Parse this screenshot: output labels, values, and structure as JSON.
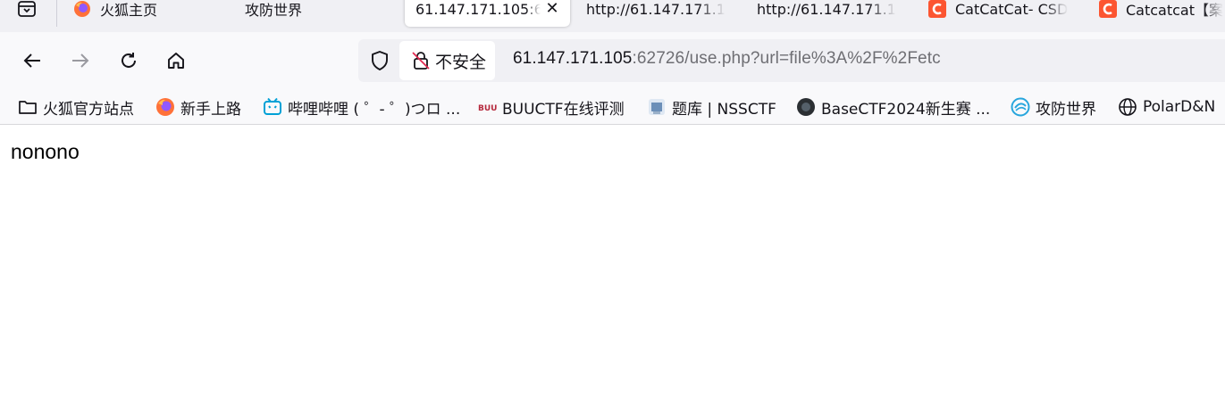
{
  "tabs": [
    {
      "title": "火狐主页",
      "icon": "firefox-icon"
    },
    {
      "title": "攻防世界",
      "icon": ""
    },
    {
      "title": "61.147.171.105:6",
      "icon": "",
      "active": true,
      "close": "✕"
    },
    {
      "title": "http://61.147.171.1",
      "icon": ""
    },
    {
      "title": "http://61.147.171.1",
      "icon": ""
    },
    {
      "title": "CatCatCat- CSD",
      "icon": "csdn-icon"
    },
    {
      "title": "Catcatcat【案",
      "icon": "csdn-icon"
    }
  ],
  "urlbar": {
    "insecure_label": "不安全",
    "host": "61.147.171.105",
    "rest": ":62726/use.php?url=file%3A%2F%2Fetc"
  },
  "bookmarks": [
    {
      "label": "火狐官方站点",
      "icon": "folder-icon"
    },
    {
      "label": "新手上路",
      "icon": "firefox-icon"
    },
    {
      "label": "哔哩哔哩 ( ゜- ゜)つロ ...",
      "icon": "bilibili-icon"
    },
    {
      "label": "BUUCTF在线评测",
      "icon": "buuctf-icon"
    },
    {
      "label": "题库 | NSSCTF",
      "icon": "nssctf-icon"
    },
    {
      "label": "BaseCTF2024新生赛 ...",
      "icon": "basectf-icon"
    },
    {
      "label": "攻防世界",
      "icon": "adworld-icon"
    },
    {
      "label": "PolarD&N",
      "icon": "globe-icon"
    }
  ],
  "page": {
    "body_text": "nonono"
  },
  "colors": {
    "tabstrip_bg": "#f0f0f4",
    "toolbar_bg": "#f9f9fb",
    "csdn_red": "#fc5531",
    "bilibili_blue": "#00a1d6"
  }
}
